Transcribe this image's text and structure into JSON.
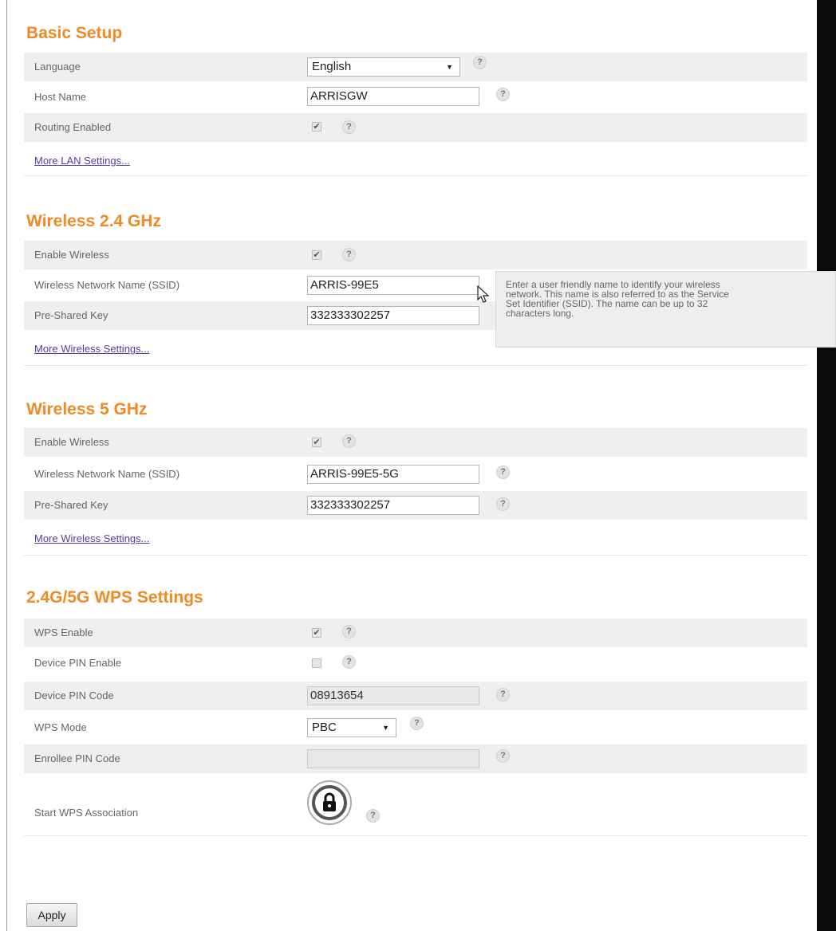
{
  "basic_setup": {
    "title": "Basic Setup",
    "language_label": "Language",
    "language_value": "English",
    "host_name_label": "Host Name",
    "host_name_value": "ARRISGW",
    "routing_enabled_label": "Routing Enabled",
    "more_link": "More LAN Settings..."
  },
  "wireless_24": {
    "title": "Wireless 2.4 GHz",
    "enable_label": "Enable Wireless",
    "ssid_label": "Wireless Network Name (SSID)",
    "ssid_value": "ARRIS-99E5",
    "psk_label": "Pre-Shared Key",
    "psk_value": "332333302257",
    "more_link": "More Wireless Settings..."
  },
  "wireless_5": {
    "title": "Wireless 5 GHz",
    "enable_label": "Enable Wireless",
    "ssid_label": "Wireless Network Name (SSID)",
    "ssid_value": "ARRIS-99E5-5G",
    "psk_label": "Pre-Shared Key",
    "psk_value": "332333302257",
    "more_link": "More Wireless Settings..."
  },
  "wps": {
    "title": "2.4G/5G WPS Settings",
    "wps_enable_label": "WPS Enable",
    "device_pin_enable_label": "Device PIN Enable",
    "device_pin_code_label": "Device PIN Code",
    "device_pin_code_value": "08913654",
    "wps_mode_label": "WPS Mode",
    "wps_mode_value": "PBC",
    "enrollee_pin_label": "Enrollee PIN Code",
    "enrollee_pin_value": "",
    "start_assoc_label": "Start WPS Association"
  },
  "tooltip": {
    "line1": "Enter a user friendly name to identify your wireless",
    "line2": "network. This name is also referred to as the Service",
    "line3": "Set Identifier (SSID). The name can be up to 32",
    "line4": "characters long."
  },
  "help_glyph": "?",
  "check_glyph": "✔",
  "select_arrow": "▼",
  "apply_label": "Apply",
  "icons": {
    "help": "help-icon",
    "lock": "lock-icon",
    "cursor": "mouse-cursor-icon"
  },
  "colors": {
    "section_title": "#f08a24",
    "link": "#5a3c99",
    "row_shade": "#efefef"
  }
}
